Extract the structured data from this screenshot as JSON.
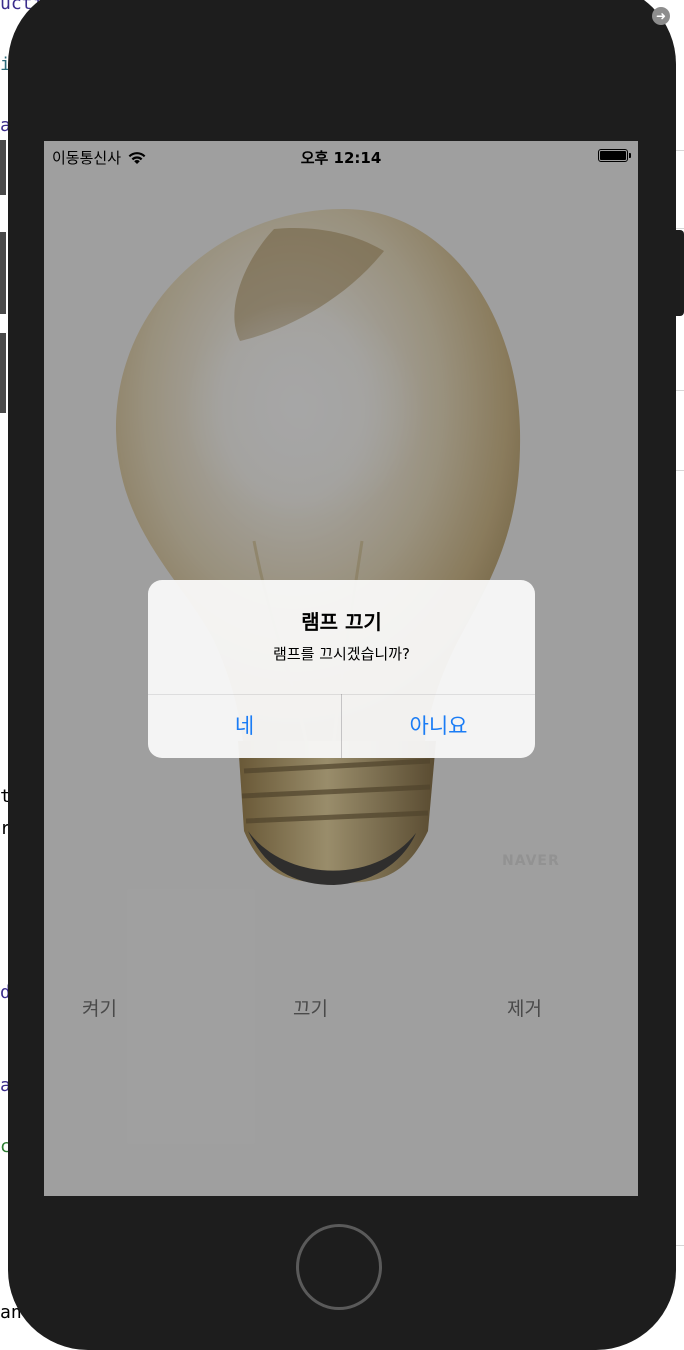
{
  "editor": {
    "fragments": [
      "ucti",
      "i",
      "a",
      "t",
      "r",
      "d",
      "a",
      "c",
      "and"
    ]
  },
  "status_bar": {
    "carrier": "이동통신사",
    "time": "오후 12:14",
    "wifi_icon": "wifi-icon",
    "battery_icon": "battery-icon"
  },
  "alert": {
    "title": "램프 끄기",
    "message": "램프를 끄시겠습니까?",
    "yes_label": "네",
    "no_label": "아니요"
  },
  "actions": {
    "on_label": "켜기",
    "off_label": "끄기",
    "remove_label": "제거"
  },
  "image": {
    "watermark": "NAVER"
  },
  "colors": {
    "device": "#1d1d1d",
    "alert_button": "#1a7cf5",
    "dim_overlay": "rgba(70,70,70,0.48)"
  }
}
